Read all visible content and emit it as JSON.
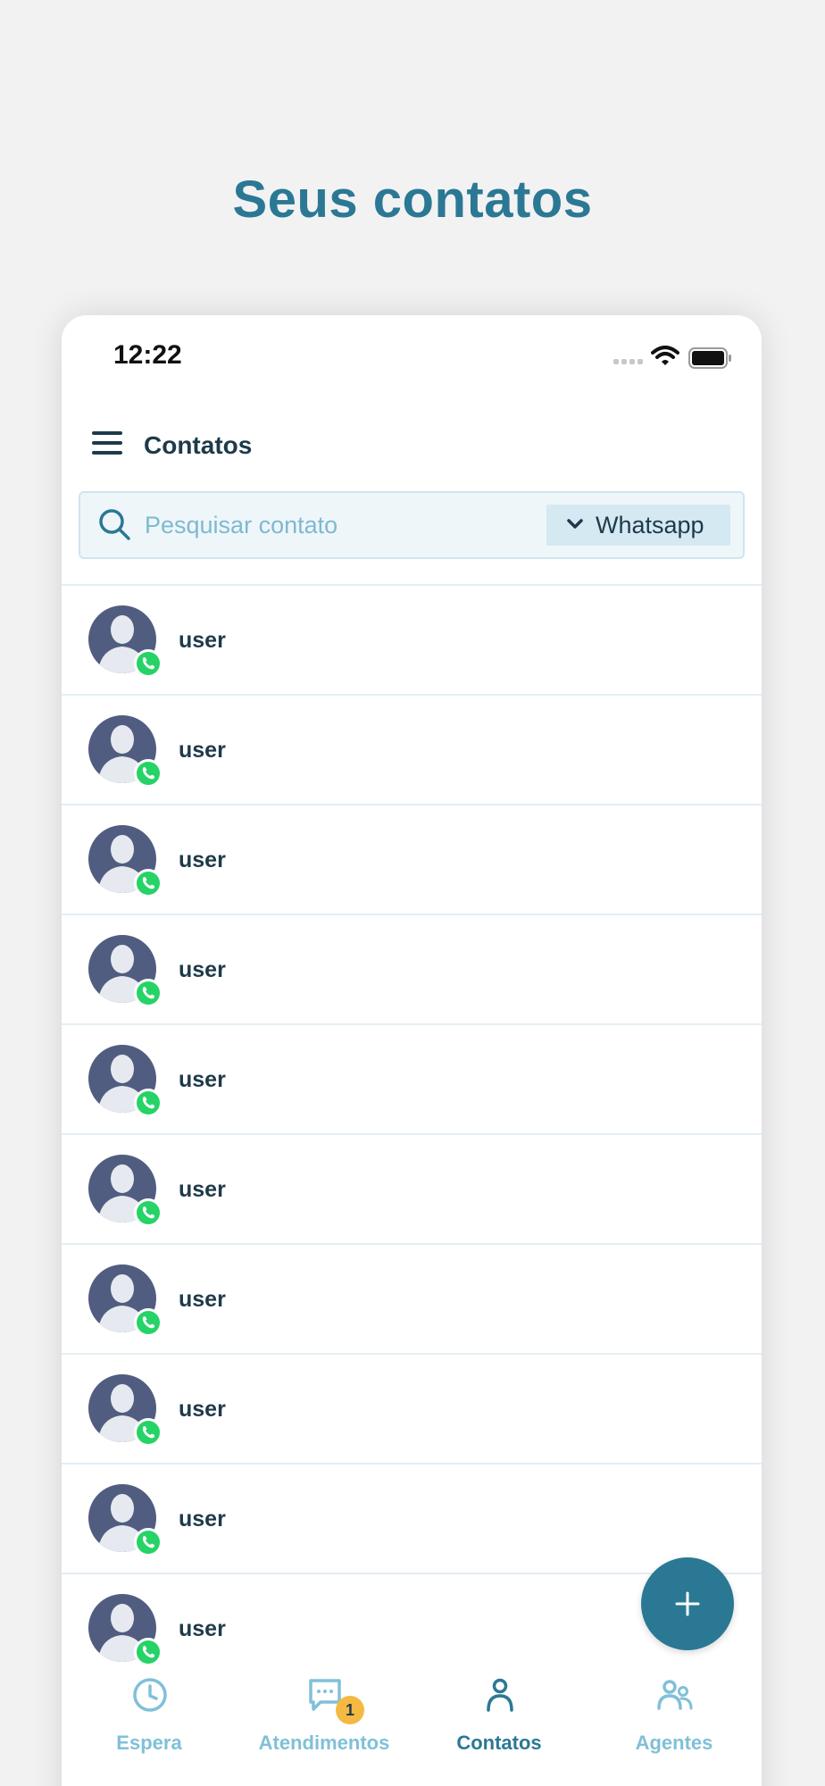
{
  "promo": {
    "headline": "Seus contatos"
  },
  "status_bar": {
    "time": "12:22"
  },
  "header": {
    "title": "Contatos",
    "menu_icon": "hamburger-menu-icon"
  },
  "search": {
    "placeholder": "Pesquisar contato",
    "value": "",
    "channel_selected": "Whatsapp"
  },
  "contacts": [
    {
      "name": "user",
      "channel": "whatsapp"
    },
    {
      "name": "user",
      "channel": "whatsapp"
    },
    {
      "name": "user",
      "channel": "whatsapp"
    },
    {
      "name": "user",
      "channel": "whatsapp"
    },
    {
      "name": "user",
      "channel": "whatsapp"
    },
    {
      "name": "user",
      "channel": "whatsapp"
    },
    {
      "name": "user",
      "channel": "whatsapp"
    },
    {
      "name": "user",
      "channel": "whatsapp"
    },
    {
      "name": "user",
      "channel": "whatsapp"
    },
    {
      "name": "user",
      "channel": "whatsapp"
    }
  ],
  "fab": {
    "icon": "plus-icon"
  },
  "bottom_nav": [
    {
      "label": "Espera",
      "icon": "clock-icon",
      "active": false
    },
    {
      "label": "Atendimentos",
      "icon": "chat-icon",
      "active": false,
      "badge": "1"
    },
    {
      "label": "Contatos",
      "icon": "person-icon",
      "active": true
    },
    {
      "label": "Agentes",
      "icon": "people-icon",
      "active": false
    }
  ],
  "colors": {
    "primary": "#2b7894",
    "nav_inactive": "#80c0d8",
    "whatsapp": "#25d366",
    "badge": "#f5b942",
    "avatar": "#515d80"
  }
}
